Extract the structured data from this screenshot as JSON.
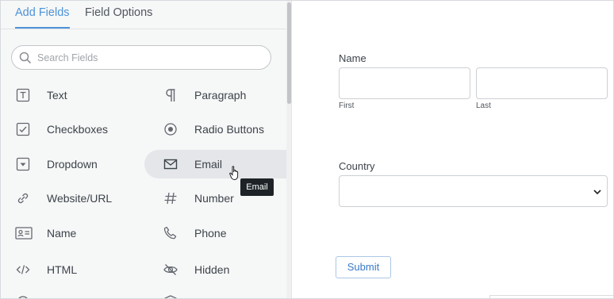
{
  "tabs": [
    {
      "label": "Add Fields"
    },
    {
      "label": "Field Options"
    }
  ],
  "search": {
    "placeholder": "Search Fields"
  },
  "fields": [
    {
      "label": "Text",
      "icon": "text-icon"
    },
    {
      "label": "Paragraph",
      "icon": "paragraph-icon"
    },
    {
      "label": "Checkboxes",
      "icon": "checkbox-icon"
    },
    {
      "label": "Radio Buttons",
      "icon": "radio-icon"
    },
    {
      "label": "Dropdown",
      "icon": "dropdown-icon"
    },
    {
      "label": "Email",
      "icon": "email-icon"
    },
    {
      "label": "Website/URL",
      "icon": "link-icon"
    },
    {
      "label": "Number",
      "icon": "hash-icon"
    },
    {
      "label": "Name",
      "icon": "name-card-icon"
    },
    {
      "label": "Phone",
      "icon": "phone-icon"
    },
    {
      "label": "HTML",
      "icon": "code-icon"
    },
    {
      "label": "Hidden",
      "icon": "eye-slash-icon"
    }
  ],
  "tooltip": {
    "text": "Email"
  },
  "form": {
    "name_label": "Name",
    "first_label": "First",
    "last_label": "Last",
    "country_label": "Country",
    "country_value": "",
    "submit_label": "Submit"
  },
  "colors": {
    "accent": "#4d93d8",
    "panel_bg": "#f6f7f7"
  }
}
